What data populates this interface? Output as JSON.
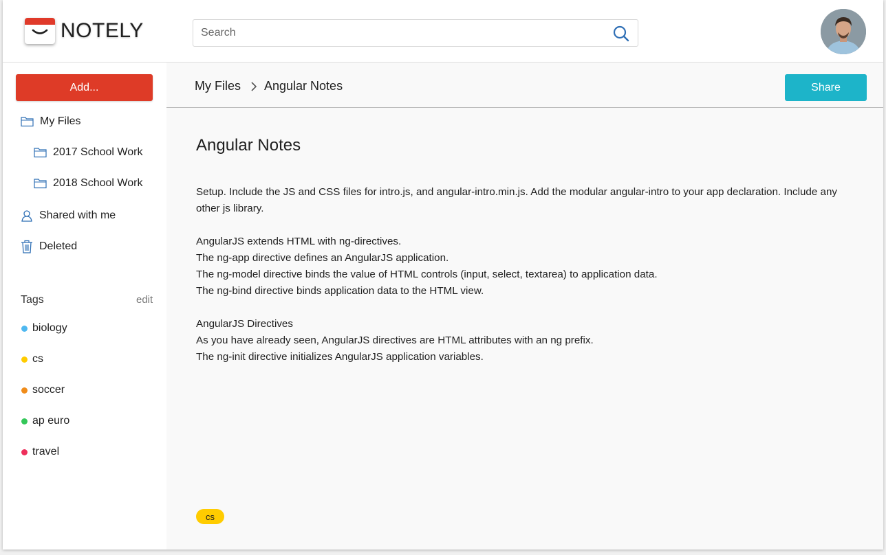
{
  "app": {
    "name": "NOTELY"
  },
  "search": {
    "placeholder": "Search"
  },
  "sidebar": {
    "add_label": "Add...",
    "items": [
      {
        "label": "My Files"
      },
      {
        "label": "2017 School Work"
      },
      {
        "label": "2018 School Work"
      },
      {
        "label": "Shared with me"
      },
      {
        "label": "Deleted"
      }
    ],
    "tags_label": "Tags",
    "tags_edit": "edit",
    "tags": [
      {
        "label": "biology",
        "color": "#4fb8f0"
      },
      {
        "label": "cs",
        "color": "#ffcc00"
      },
      {
        "label": "soccer",
        "color": "#f08c1a"
      },
      {
        "label": "ap euro",
        "color": "#34c759"
      },
      {
        "label": "travel",
        "color": "#ee2f5b"
      }
    ]
  },
  "breadcrumb": {
    "root": "My Files",
    "current": "Angular Notes"
  },
  "toolbar": {
    "share_label": "Share"
  },
  "note": {
    "title": "Angular Notes",
    "paragraphs": [
      [
        "Setup. Include the JS and CSS files for intro.js, and angular-intro.min.js. Add the modular angular-intro to your app declaration. Include any other js library."
      ],
      [
        "AngularJS extends HTML with ng-directives.",
        "The ng-app directive defines an AngularJS application.",
        "The ng-model directive binds the value of HTML controls (input, select, textarea) to application data.",
        "The ng-bind directive binds application data to the HTML view."
      ],
      [
        "AngularJS Directives",
        "As you have already seen, AngularJS directives are HTML attributes with an ng prefix.",
        "The ng-init directive initializes AngularJS application variables."
      ]
    ],
    "tag": "cs"
  },
  "colors": {
    "accent_red": "#de3b27",
    "share_teal": "#1db4c9",
    "icon_blue": "#2f6fb5"
  }
}
